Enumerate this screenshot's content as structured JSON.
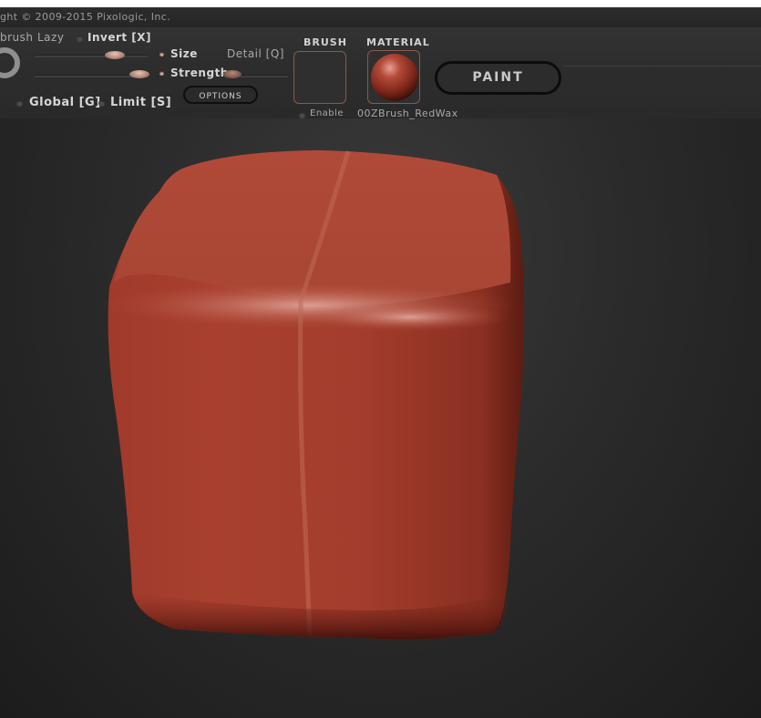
{
  "app": {
    "copyright": "ght © 2009-2015 Pixologic, Inc."
  },
  "toolbar": {
    "zbrush_label": "brush",
    "lazy_label": "Lazy",
    "invert_label": "Invert [X]",
    "size_label": "Size",
    "detail_label": "Detail [Q]",
    "strength_label": "Strength",
    "options_label": "OPTIONS",
    "global_label": "Global [G]",
    "limit_label": "Limit [S]"
  },
  "brush": {
    "title": "BRUSH",
    "enable_label": "Enable"
  },
  "material": {
    "title": "MATERIAL",
    "name": "00ZBrush_RedWax"
  },
  "paint": {
    "label": "PAINT"
  },
  "colors": {
    "accent": "#8a5a48",
    "model": "#a8412f"
  }
}
